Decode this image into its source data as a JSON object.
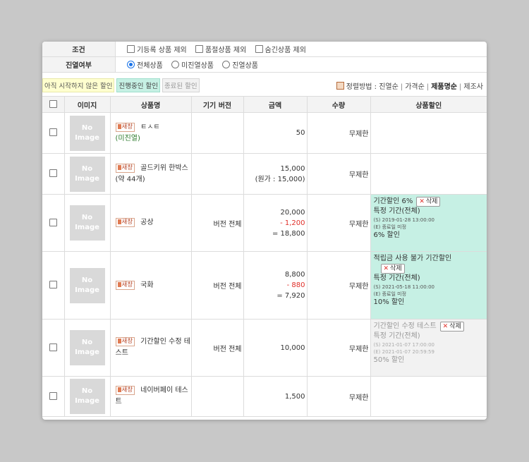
{
  "filters": {
    "condition": {
      "label": "조건",
      "options": [
        "기등록 상품 제외",
        "품절상품 제외",
        "숨긴상품 제외"
      ]
    },
    "display": {
      "label": "진열여부",
      "options": [
        "전체상품",
        "미진열상품",
        "진열상품"
      ],
      "selected": "전체상품"
    }
  },
  "status_tabs": [
    "아직 시작하지 않은 할인",
    "진행중인 할인",
    "종료된 할인"
  ],
  "sort": {
    "label": "정렬방법 :",
    "options": [
      "진열순",
      "가격순",
      "제품명순",
      "제조사"
    ],
    "active": "제품명순",
    "separator": "|"
  },
  "columns": [
    "이미지",
    "상품명",
    "기기 버전",
    "금액",
    "수량",
    "상품할인"
  ],
  "no_image": [
    "No",
    "Image"
  ],
  "new_window_label": "새창",
  "delete_label": "삭제",
  "rows": [
    {
      "name": "ㅌㅅㅌ",
      "note": "(미진열)",
      "version": "",
      "amount": "50",
      "amount_extra": "",
      "discount_amount": "",
      "final_amount": "",
      "qty": "무제한"
    },
    {
      "name": "골드키위 한박스(약 44개)",
      "note": "",
      "version": "",
      "amount": "15,000",
      "amount_extra": "(원가 : 15,000)",
      "discount_amount": "",
      "final_amount": "",
      "qty": "무제한"
    },
    {
      "name": "공상",
      "note": "",
      "version": "버전 전체",
      "amount": "20,000",
      "amount_extra": "",
      "discount_amount": "- 1,200",
      "final_amount": "= 18,800",
      "qty": "무제한",
      "discount": {
        "style": "green",
        "title": "기간할인 6%",
        "period": "특정 기간(전체)",
        "start": "(S) 2019-01-28 13:00:00",
        "end": "(E) 종료일 미정",
        "rate": "6% 할인"
      }
    },
    {
      "name": "국화",
      "note": "",
      "version": "버전 전체",
      "amount": "8,800",
      "amount_extra": "",
      "discount_amount": "- 880",
      "final_amount": "= 7,920",
      "qty": "무제한",
      "discount": {
        "style": "green",
        "title": "적립금 사용 불가 기간할인",
        "period": "특정 기간(전체)",
        "start": "(S) 2021-05-18 11:00:00",
        "end": "(E) 종료일 미정",
        "rate": "10% 할인"
      }
    },
    {
      "name": "기간할인 수정 테스트",
      "note": "",
      "version": "버전 전체",
      "amount": "10,000",
      "amount_extra": "",
      "discount_amount": "",
      "final_amount": "",
      "qty": "무제한",
      "discount": {
        "style": "grey",
        "title": "기간할인 수정 테스트",
        "period": "특정 기간(전체)",
        "start": "(S) 2021-01-07 17:00:00",
        "end": "(E) 2021-01-07 20:59:59",
        "rate": "50% 할인"
      }
    },
    {
      "name": "네이버페이 테스트",
      "note": "",
      "version": "",
      "amount": "1,500",
      "amount_extra": "",
      "discount_amount": "",
      "final_amount": "",
      "qty": "무제한"
    }
  ]
}
